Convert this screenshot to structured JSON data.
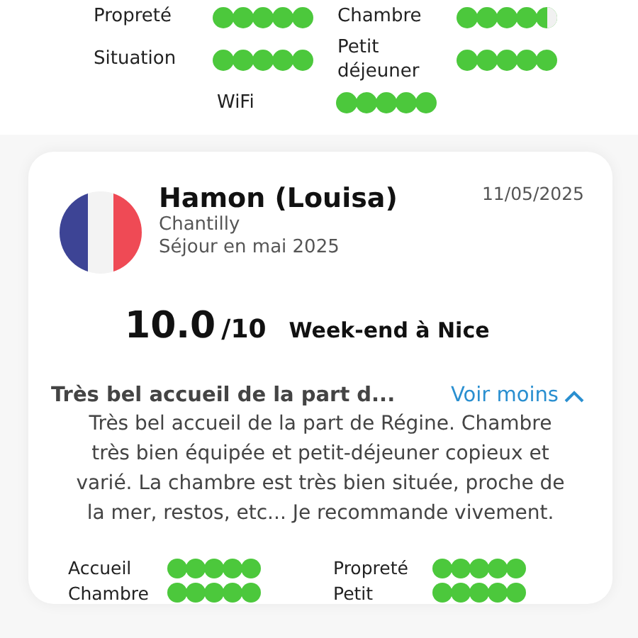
{
  "top_ratings": [
    {
      "label": "Propreté",
      "stars": 5
    },
    {
      "label": "Chambre",
      "stars": 4.5
    },
    {
      "label": "Situation",
      "stars": 5
    },
    {
      "label": "Petit déjeuner",
      "stars": 5
    },
    {
      "label": "WiFi",
      "stars": 5
    }
  ],
  "review": {
    "name": "Hamon (Louisa)",
    "city": "Chantilly",
    "stay": "Séjour en mai 2025",
    "date": "11/05/2025",
    "score": "10.0",
    "scale": "/10",
    "trip": "Week-end à Nice",
    "title": "Très bel accueil de la part d...",
    "toggle": "Voir moins",
    "expanded": true,
    "text": "Très bel accueil de la part de Régine. Chambre très bien équipée et petit-déjeuner copieux et varié. La chambre est très bien située, proche de la mer, restos, etc... Je recommande vivement.",
    "ratings": [
      {
        "label": "Accueil",
        "stars": 5
      },
      {
        "label": "Propreté",
        "stars": 5
      },
      {
        "label": "Chambre",
        "stars": 5
      },
      {
        "label": "Petit",
        "stars": 5
      }
    ]
  }
}
